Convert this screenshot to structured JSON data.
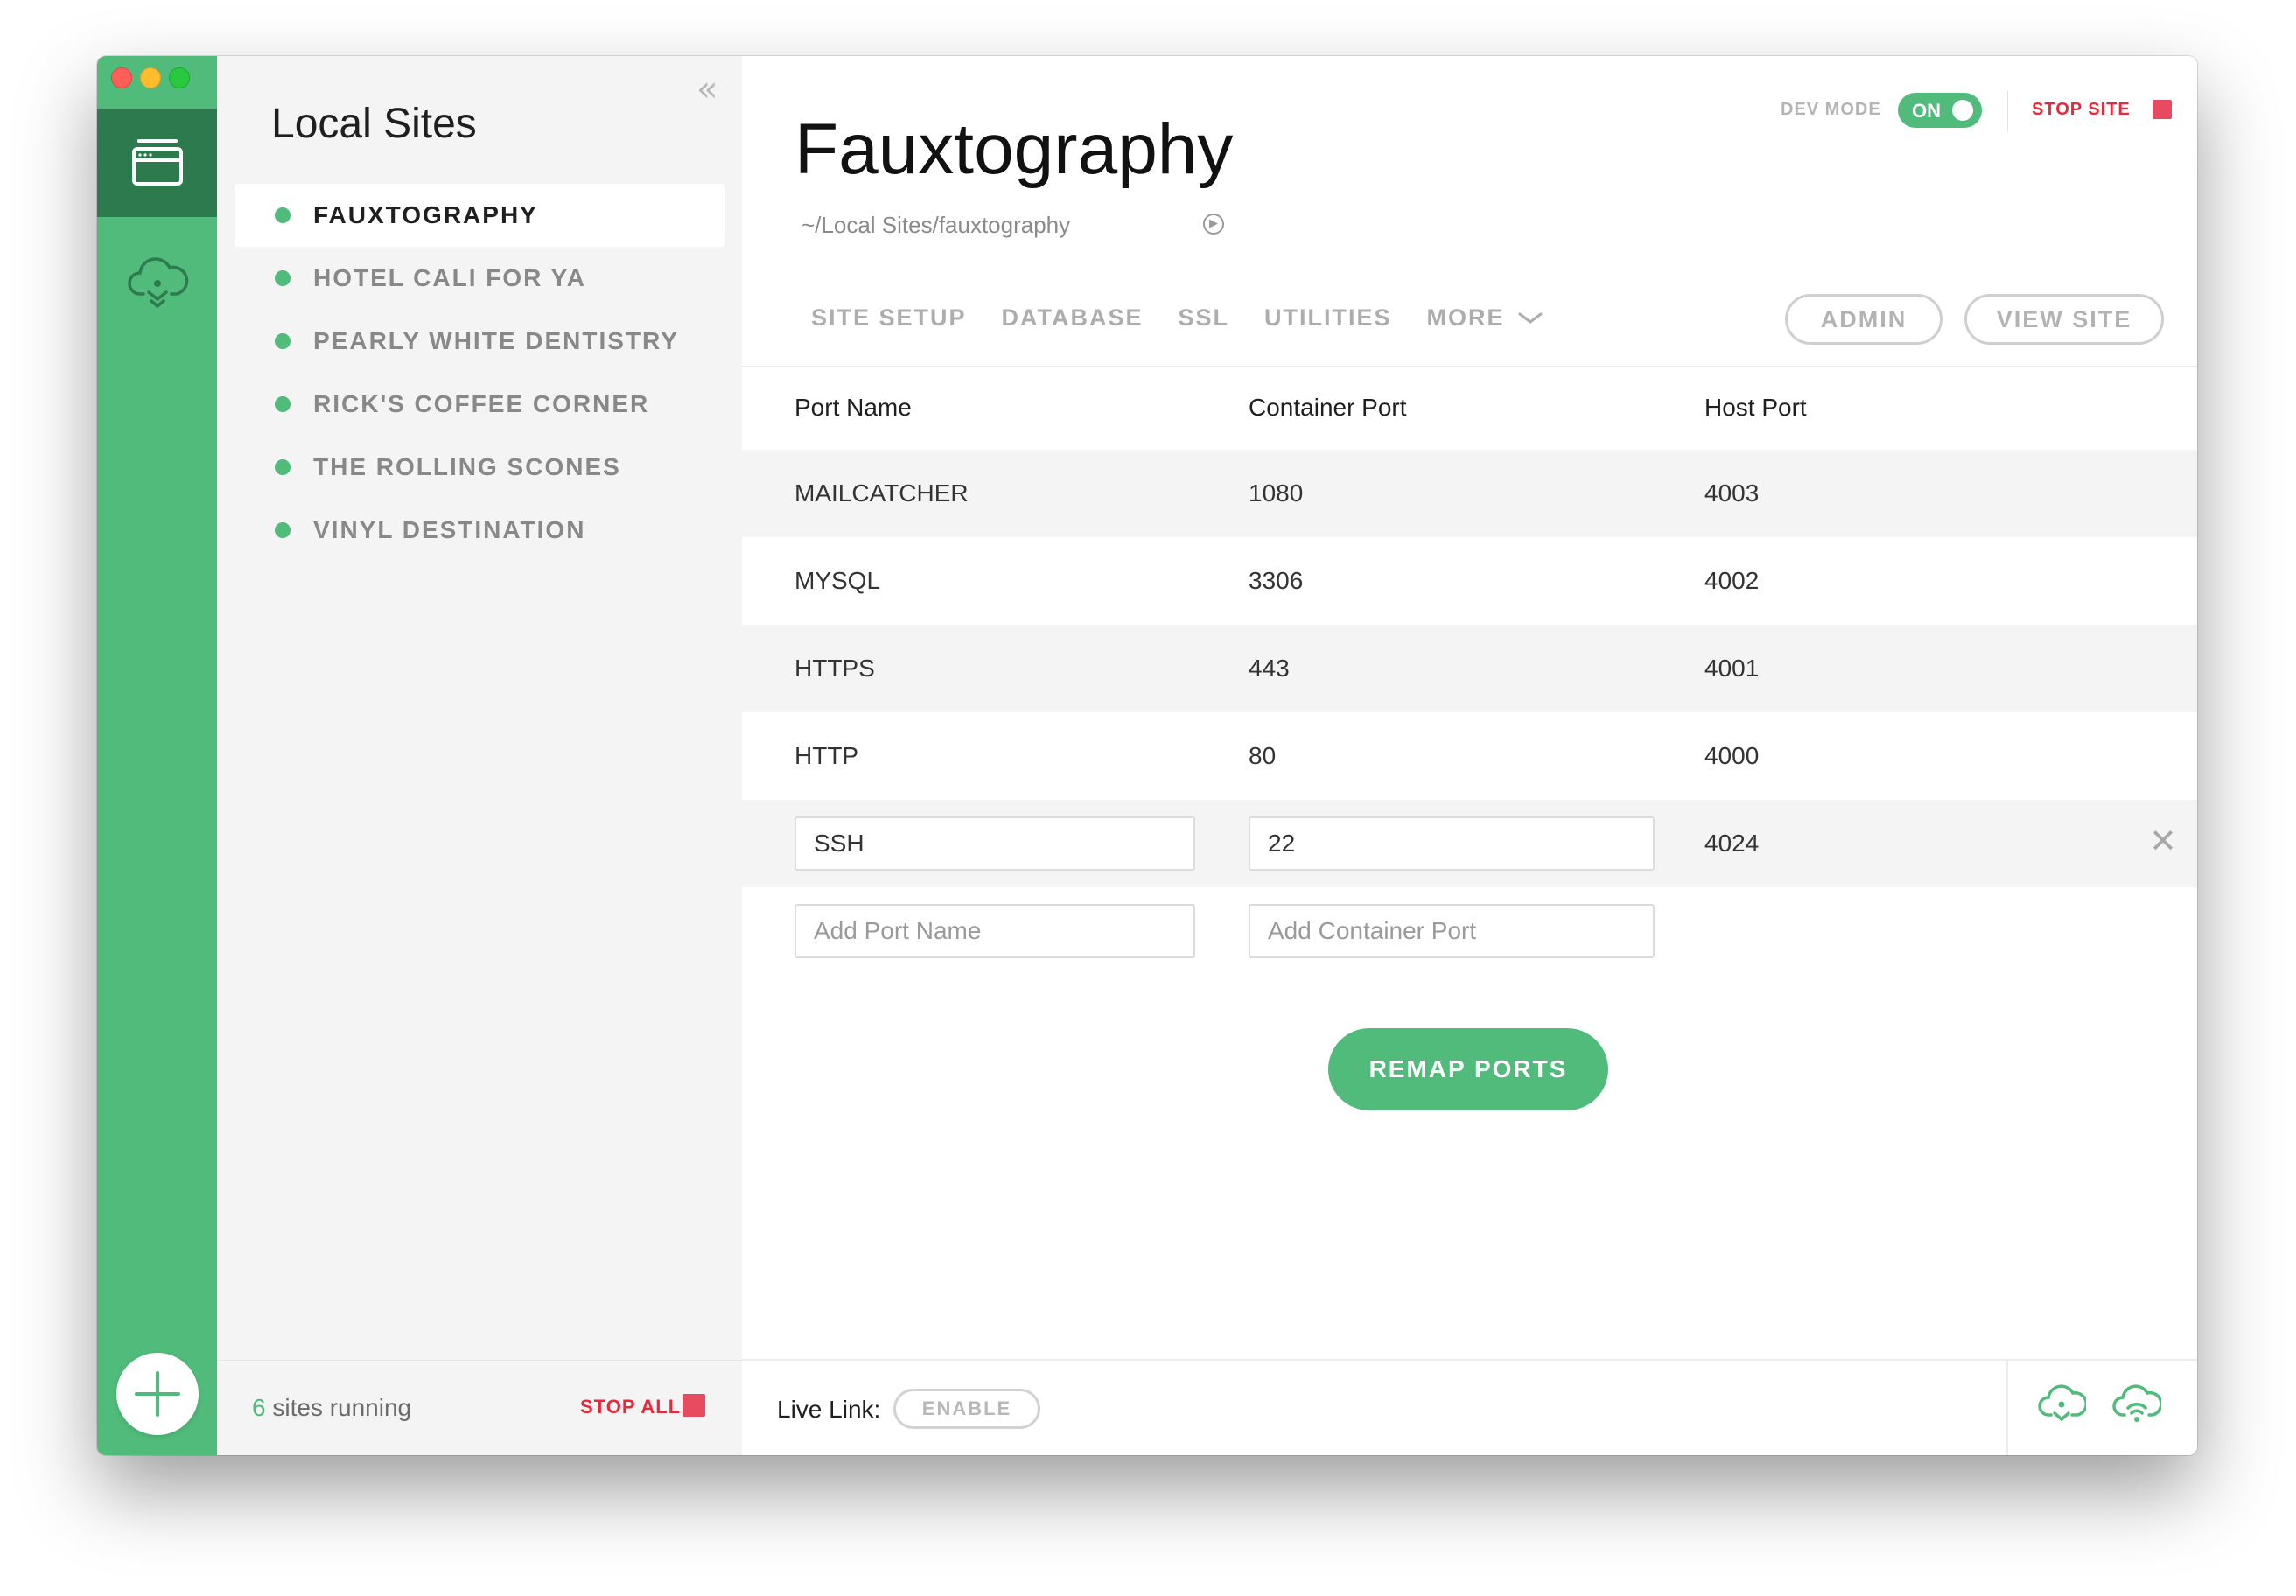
{
  "window": {
    "buttons": [
      "close",
      "minimize",
      "zoom"
    ]
  },
  "rail": {
    "items": [
      {
        "icon": "local-sites-icon",
        "active": true
      },
      {
        "icon": "connect-cloud-icon",
        "active": false
      }
    ],
    "add_icon": "plus-icon"
  },
  "sidebar": {
    "collapse_icon": "double-chevron-left-icon",
    "title": "Local Sites",
    "sites": [
      {
        "label": "FAUXTOGRAPHY",
        "active": true,
        "status_color": "#51bb7b"
      },
      {
        "label": "HOTEL CALI FOR YA",
        "active": false,
        "status_color": "#51bb7b"
      },
      {
        "label": "PEARLY WHITE DENTISTRY",
        "active": false,
        "status_color": "#51bb7b"
      },
      {
        "label": "RICK'S COFFEE CORNER",
        "active": false,
        "status_color": "#51bb7b"
      },
      {
        "label": "THE ROLLING SCONES",
        "active": false,
        "status_color": "#51bb7b"
      },
      {
        "label": "VINYL DESTINATION",
        "active": false,
        "status_color": "#51bb7b"
      }
    ],
    "footer": {
      "running_count": "6",
      "running_text": "sites running",
      "stop_all_label": "STOP ALL"
    }
  },
  "header": {
    "site_name": "Fauxtography",
    "site_path": "~/Local Sites/fauxtography",
    "dev_mode_label": "DEV MODE",
    "dev_mode_state": "ON",
    "stop_site_label": "STOP SITE"
  },
  "tabs": [
    {
      "label": "SITE SETUP"
    },
    {
      "label": "DATABASE"
    },
    {
      "label": "SSL"
    },
    {
      "label": "UTILITIES"
    },
    {
      "label": "MORE"
    }
  ],
  "actions": {
    "admin_label": "ADMIN",
    "view_site_label": "VIEW SITE"
  },
  "ports": {
    "columns": [
      "Port Name",
      "Container Port",
      "Host Port"
    ],
    "rows": [
      {
        "name": "MAILCATCHER",
        "container": "1080",
        "host": "4003"
      },
      {
        "name": "MYSQL",
        "container": "3306",
        "host": "4002"
      },
      {
        "name": "HTTPS",
        "container": "443",
        "host": "4001"
      },
      {
        "name": "HTTP",
        "container": "80",
        "host": "4000"
      }
    ],
    "editable_row": {
      "name": "SSH",
      "container": "22",
      "host": "4024"
    },
    "new_row": {
      "name_placeholder": "Add Port Name",
      "container_placeholder": "Add Container Port"
    },
    "remap_label": "REMAP PORTS"
  },
  "footer": {
    "live_link_label": "Live Link:",
    "enable_label": "ENABLE"
  },
  "colors": {
    "accent": "#51bb7b",
    "accent_dark": "#2d7a4f",
    "danger": "#e84a5f"
  }
}
